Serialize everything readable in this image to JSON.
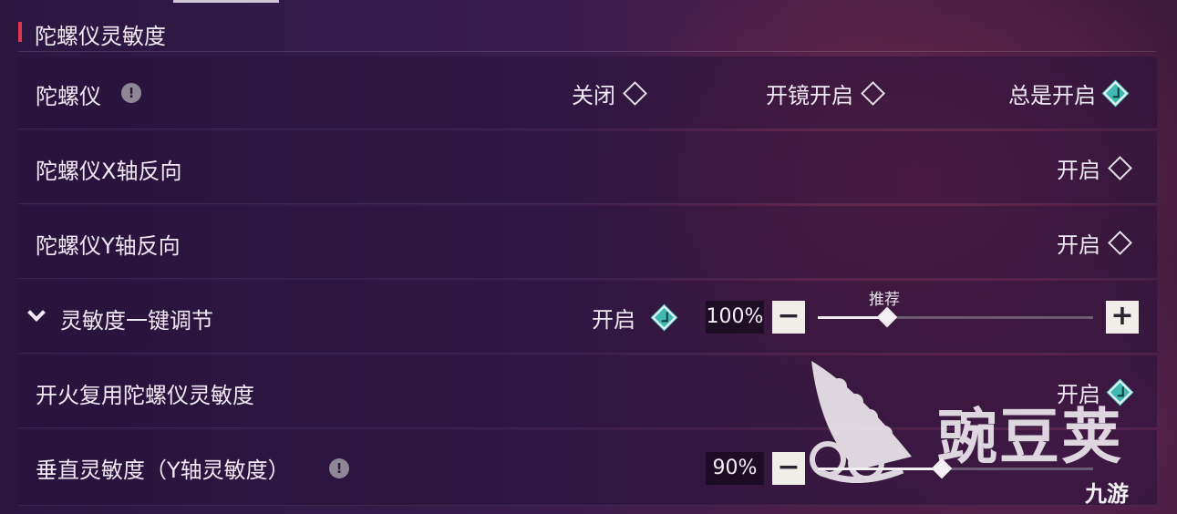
{
  "section": {
    "title": "陀螺仪灵敏度"
  },
  "rows": {
    "gyro": {
      "label": "陀螺仪",
      "info": "!",
      "options": [
        {
          "label": "关闭",
          "selected": false
        },
        {
          "label": "开镜开启",
          "selected": false
        },
        {
          "label": "总是开启",
          "selected": true
        }
      ]
    },
    "x_invert": {
      "label": "陀螺仪X轴反向",
      "option": {
        "label": "开启",
        "selected": false
      }
    },
    "y_invert": {
      "label": "陀螺仪Y轴反向",
      "option": {
        "label": "开启",
        "selected": false
      }
    },
    "one_key": {
      "label": "灵敏度一键调节",
      "option": {
        "label": "开启",
        "selected": true
      },
      "value": "100%",
      "minus": "−",
      "plus": "+",
      "slider_fraction": 0.25,
      "recommend_label": "推荐"
    },
    "fire_reuse": {
      "label": "开火复用陀螺仪灵敏度",
      "option": {
        "label": "开启",
        "selected": true
      }
    },
    "vertical": {
      "label": "垂直灵敏度（Y轴灵敏度）",
      "info": "!",
      "value": "90%",
      "minus": "−",
      "slider_fraction": 0.45
    }
  },
  "watermark": {
    "text": "豌豆荚",
    "logo": "九游"
  },
  "colors": {
    "accent_red": "#e0364e",
    "teal_selected": "#3fb9b1"
  }
}
